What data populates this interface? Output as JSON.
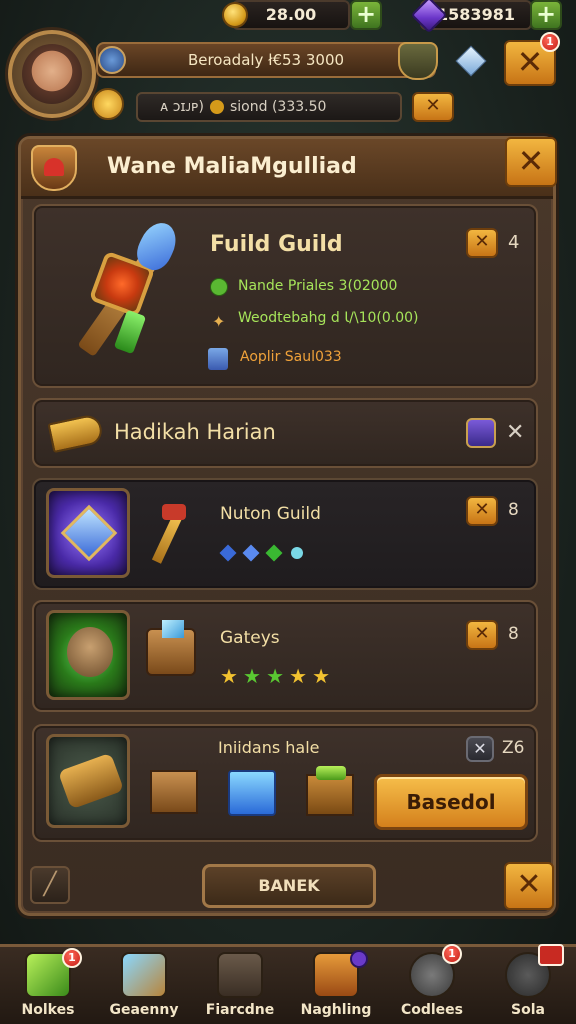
{
  "currency": {
    "gold": "28.00",
    "gems": "1583981"
  },
  "player": {
    "name_bar": "Beroadaly ł€53 3000",
    "sub_left": "ᴀ ɔɪᴊᴘ)",
    "sub_right": "siond (333.50"
  },
  "header": {
    "notification_count": "1"
  },
  "panel": {
    "title": "Wane MaliaMgulliad"
  },
  "guild_card": {
    "title": "Fuild Guild",
    "count": "4",
    "line1": "Nande Priales 3(02000",
    "line2": "Weodtebahg d Ɩ/\\10(0.00)",
    "line3": "Aoplir Saul033"
  },
  "section_header": {
    "title": "Hadikah Harian"
  },
  "rows": [
    {
      "title": "Nuton Guild",
      "count": "8"
    },
    {
      "title": "Gateys",
      "count": "8"
    },
    {
      "title": "Iniidans hale",
      "count": "Z6",
      "button": "Basedol"
    }
  ],
  "footer": {
    "button": "BANEK"
  },
  "nav": {
    "items": [
      {
        "label": "Nolkes",
        "badge": "1"
      },
      {
        "label": "Geaenny",
        "badge": ""
      },
      {
        "label": "Fiarcdne",
        "badge": ""
      },
      {
        "label": "Naghling",
        "badge": ""
      },
      {
        "label": "Codlees",
        "badge": "1"
      },
      {
        "label": "Sola",
        "badge": ""
      }
    ]
  },
  "colors": {
    "accent_gold": "#f2b640",
    "panel_bg": "#4a382a",
    "plus_green": "#7ab43a",
    "badge_red": "#c41a12"
  },
  "icons": [
    "gold-coin-icon",
    "purple-gem-icon",
    "plus-icon",
    "close-icon",
    "shield-icon",
    "heart-crest-icon",
    "weapon-icon",
    "star-icon",
    "chest-icon"
  ]
}
